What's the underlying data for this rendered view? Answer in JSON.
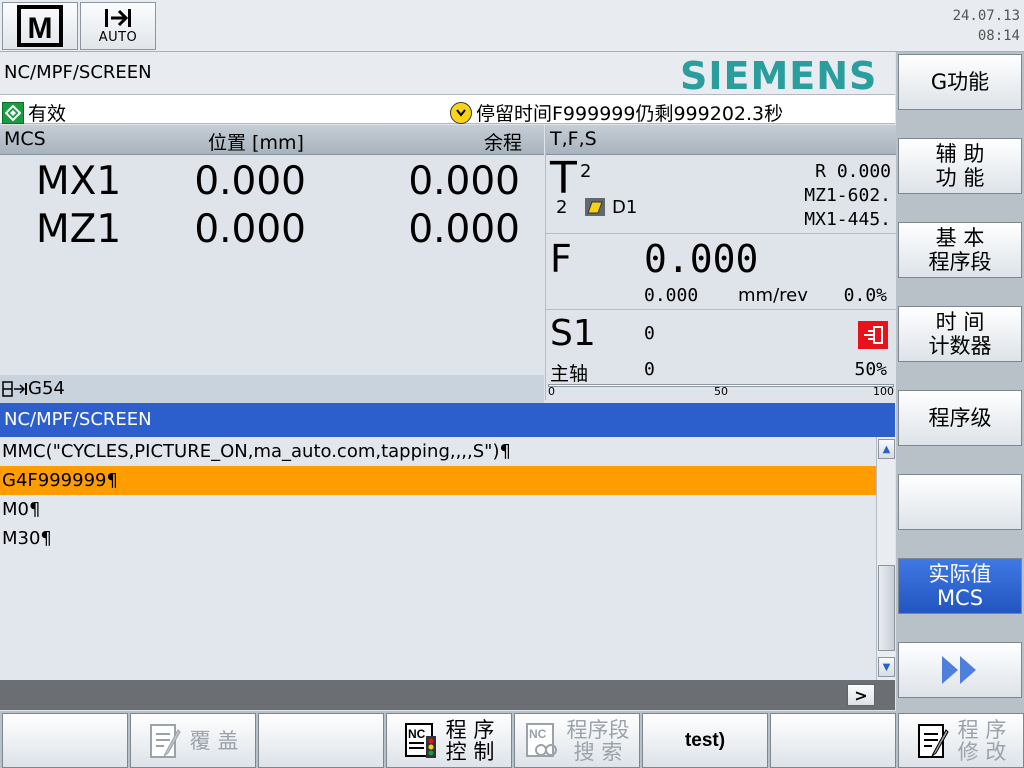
{
  "top": {
    "mode_letter": "M",
    "mode_label": "AUTO",
    "date": "24.07.13",
    "time": "08:14"
  },
  "header": {
    "path": "NC/MPF/SCREEN",
    "brand": "SIEMENS"
  },
  "status": {
    "channel_state": "有效",
    "message": "停留时间F999999仍剩999202.3秒"
  },
  "axis_panel": {
    "col_system": "MCS",
    "col_position": "位置 [mm]",
    "col_remaining": "余程",
    "axes": [
      {
        "name": "MX1",
        "position": "0.000",
        "remaining": "0.000"
      },
      {
        "name": "MZ1",
        "position": "0.000",
        "remaining": "0.000"
      }
    ],
    "work_offset": "G54"
  },
  "tfs": {
    "title": "T,F,S",
    "t_label": "T",
    "tool_number": "2",
    "tool_sub": "2",
    "d_label": "D1",
    "radius": "R 0.000",
    "tool_z": "MZ1-602.",
    "tool_x": "MX1-445.",
    "f_label": "F",
    "feed_value": "0.000",
    "feed_actual": "0.000",
    "feed_unit": "mm/rev",
    "feed_override": "0.0%",
    "s_label": "S1",
    "spindle_speed": "0",
    "spindle_main_label": "主轴",
    "spindle_main_value": "0",
    "spindle_override": "50%",
    "scale_min": "0",
    "scale_mid": "50",
    "scale_max": "100",
    "spindle_load_pct": 0
  },
  "program": {
    "title": "NC/MPF/SCREEN",
    "lines": [
      "MMC(\"CYCLES,PICTURE_ON,ma_auto.com,tapping,,,,S\")¶",
      "G4F999999¶",
      "M0¶",
      "M30¶"
    ],
    "selected_index": 1,
    "scroll_right_label": ">"
  },
  "right_softkeys": [
    {
      "label": "G功能"
    },
    {
      "label": "辅 助\n功 能"
    },
    {
      "label": "基 本\n程序段"
    },
    {
      "label": "时 间\n计数器"
    },
    {
      "label": "程序级"
    },
    {
      "label": ""
    },
    {
      "label": "实际值\nMCS"
    },
    {
      "label": "▶▶"
    }
  ],
  "bottom_softkeys": [
    {
      "label": ""
    },
    {
      "label": "覆 盖"
    },
    {
      "label": ""
    },
    {
      "label": "程 序\n控 制"
    },
    {
      "label": "程序段\n搜 索"
    },
    {
      "label": "test)"
    },
    {
      "label": ""
    },
    {
      "label": "程 序\n修 改"
    }
  ],
  "colors": {
    "title_bar": "#2c5fcc",
    "selection": "#ff9d00",
    "brand": "#2a9d9d",
    "active_softkey": "#2255c0",
    "spindle_icon": "#e8121a"
  },
  "icons": {
    "mode": "machine-mode-icon",
    "auto": "auto-arrow-icon",
    "channel_ok": "green-diamond-icon",
    "message": "yellow-clock-icon",
    "tool": "insert-tool-icon",
    "spindle": "spindle-state-icon",
    "next": "double-arrow-icon"
  }
}
